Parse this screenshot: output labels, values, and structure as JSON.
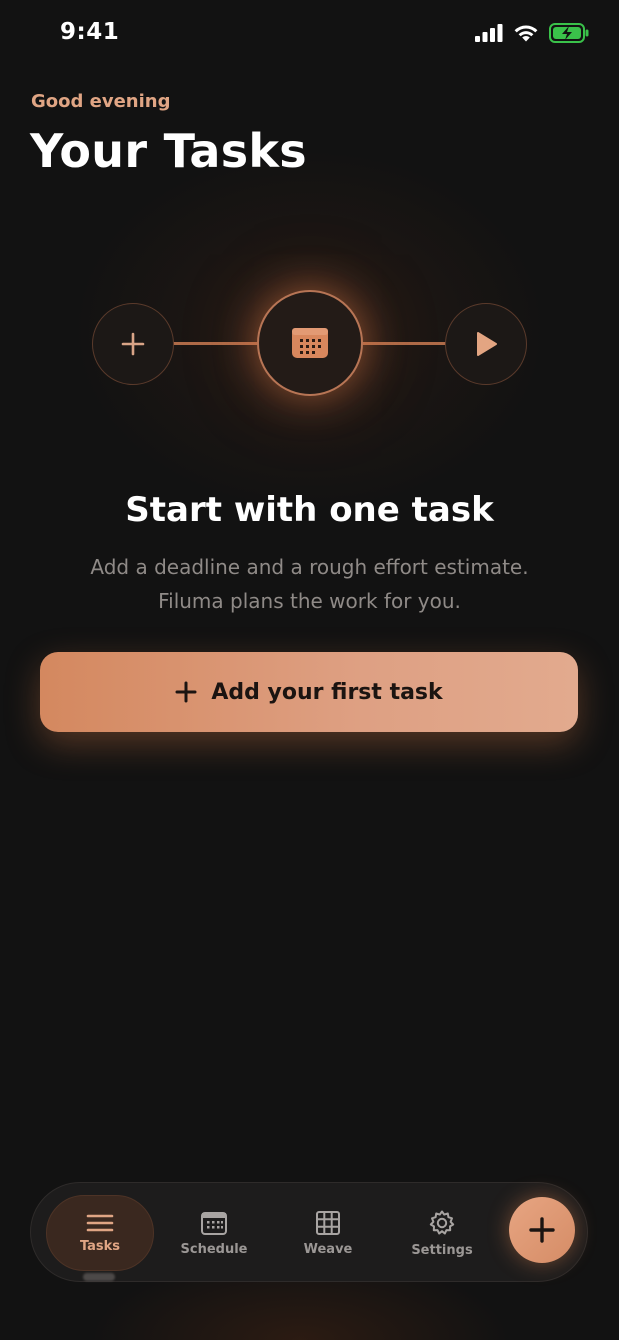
{
  "status_bar": {
    "time": "9:41",
    "icons": [
      "signal-icon",
      "wifi-icon",
      "battery-charging-icon"
    ]
  },
  "header": {
    "greeting": "Good evening",
    "title": "Your Tasks"
  },
  "flow": {
    "steps": [
      "plus-icon",
      "calendar-icon",
      "play-icon"
    ]
  },
  "empty_state": {
    "headline": "Start with one task",
    "subtext_line1": "Add a deadline and a rough effort estimate.",
    "subtext_line2": "Filuma plans the work for you."
  },
  "cta": {
    "label": "Add your first task",
    "icon": "plus-icon"
  },
  "tabbar": {
    "items": [
      {
        "label": "Tasks",
        "icon": "list-icon",
        "active": true
      },
      {
        "label": "Schedule",
        "icon": "calendar-icon",
        "active": false
      },
      {
        "label": "Weave",
        "icon": "grid-icon",
        "active": false
      },
      {
        "label": "Settings",
        "icon": "gear-icon",
        "active": false
      }
    ],
    "fab_icon": "plus-icon"
  },
  "colors": {
    "accent": "#d4885f",
    "accent_light": "#e0a584",
    "background": "#121212",
    "battery": "#3ac24a"
  }
}
